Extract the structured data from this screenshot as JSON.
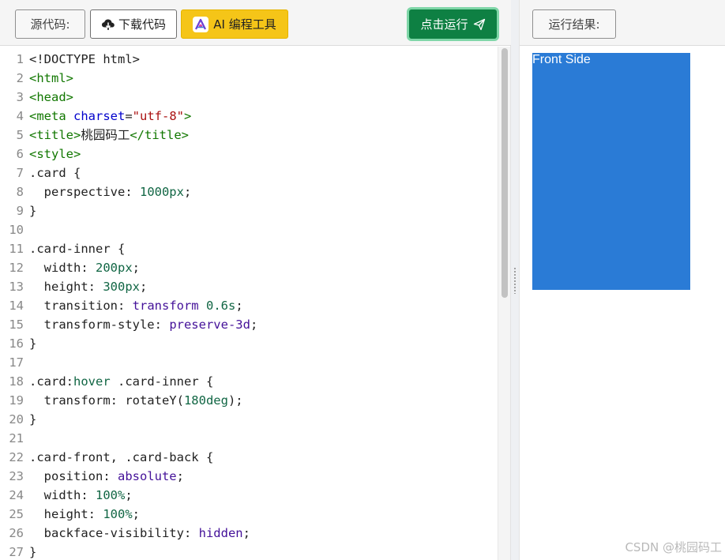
{
  "toolbar": {
    "source_label": "源代码:",
    "download_label": "下载代码",
    "ai_label": "AI 编程工具",
    "run_label": "点击运行"
  },
  "result_toolbar": {
    "result_label": "运行结果:"
  },
  "editor": {
    "line_numbers": [
      "1",
      "2",
      "3",
      "4",
      "5",
      "6",
      "7",
      "8",
      "9",
      "10",
      "11",
      "12",
      "13",
      "14",
      "15",
      "16",
      "17",
      "18",
      "19",
      "20",
      "21",
      "22",
      "23",
      "24",
      "25",
      "26",
      "27"
    ],
    "code": [
      [
        {
          "t": "<!DOCTYPE html>",
          "c": ""
        }
      ],
      [
        {
          "t": "<html>",
          "c": "tag"
        }
      ],
      [
        {
          "t": "<head>",
          "c": "tag"
        }
      ],
      [
        {
          "t": "<meta ",
          "c": "tag"
        },
        {
          "t": "charset",
          "c": "attr"
        },
        {
          "t": "=",
          "c": ""
        },
        {
          "t": "\"utf-8\"",
          "c": "str"
        },
        {
          "t": ">",
          "c": "tag"
        }
      ],
      [
        {
          "t": "<title>",
          "c": "tag"
        },
        {
          "t": "桃园码工",
          "c": "cjk"
        },
        {
          "t": "</title>",
          "c": "tag"
        }
      ],
      [
        {
          "t": "<style>",
          "c": "tag"
        }
      ],
      [
        {
          "t": ".card {",
          "c": ""
        }
      ],
      [
        {
          "t": "  perspective: ",
          "c": ""
        },
        {
          "t": "1000px",
          "c": "num"
        },
        {
          "t": ";",
          "c": ""
        }
      ],
      [
        {
          "t": "}",
          "c": ""
        }
      ],
      [
        {
          "t": "",
          "c": ""
        }
      ],
      [
        {
          "t": ".card-inner {",
          "c": ""
        }
      ],
      [
        {
          "t": "  width: ",
          "c": ""
        },
        {
          "t": "200px",
          "c": "num"
        },
        {
          "t": ";",
          "c": ""
        }
      ],
      [
        {
          "t": "  height: ",
          "c": ""
        },
        {
          "t": "300px",
          "c": "num"
        },
        {
          "t": ";",
          "c": ""
        }
      ],
      [
        {
          "t": "  transition: ",
          "c": ""
        },
        {
          "t": "transform",
          "c": "kw"
        },
        {
          "t": " ",
          "c": ""
        },
        {
          "t": "0.6s",
          "c": "num"
        },
        {
          "t": ";",
          "c": ""
        }
      ],
      [
        {
          "t": "  transform-style: ",
          "c": ""
        },
        {
          "t": "preserve-3d",
          "c": "kw"
        },
        {
          "t": ";",
          "c": ""
        }
      ],
      [
        {
          "t": "}",
          "c": ""
        }
      ],
      [
        {
          "t": "",
          "c": ""
        }
      ],
      [
        {
          "t": ".card:",
          "c": ""
        },
        {
          "t": "hover",
          "c": "num"
        },
        {
          "t": " .card-inner {",
          "c": ""
        }
      ],
      [
        {
          "t": "  transform: rotateY(",
          "c": ""
        },
        {
          "t": "180deg",
          "c": "num"
        },
        {
          "t": ");",
          "c": ""
        }
      ],
      [
        {
          "t": "}",
          "c": ""
        }
      ],
      [
        {
          "t": "",
          "c": ""
        }
      ],
      [
        {
          "t": ".card-front, .card-back {",
          "c": ""
        }
      ],
      [
        {
          "t": "  position: ",
          "c": ""
        },
        {
          "t": "absolute",
          "c": "kw"
        },
        {
          "t": ";",
          "c": ""
        }
      ],
      [
        {
          "t": "  width: ",
          "c": ""
        },
        {
          "t": "100%",
          "c": "num"
        },
        {
          "t": ";",
          "c": ""
        }
      ],
      [
        {
          "t": "  height: ",
          "c": ""
        },
        {
          "t": "100%",
          "c": "num"
        },
        {
          "t": ";",
          "c": ""
        }
      ],
      [
        {
          "t": "  backface-visibility: ",
          "c": ""
        },
        {
          "t": "hidden",
          "c": "kw"
        },
        {
          "t": ";",
          "c": ""
        }
      ],
      [
        {
          "t": "}",
          "c": ""
        }
      ]
    ]
  },
  "preview": {
    "card_text": "Front Side",
    "card_color": "#2a7bd6"
  },
  "watermark": "CSDN @桃园码工",
  "icons": {
    "download": "cloud-download-icon",
    "ai": "ai-tool-logo-icon",
    "run": "send-plane-icon"
  },
  "colors": {
    "run_button": "#0e8043",
    "ai_button": "#f5c518"
  }
}
